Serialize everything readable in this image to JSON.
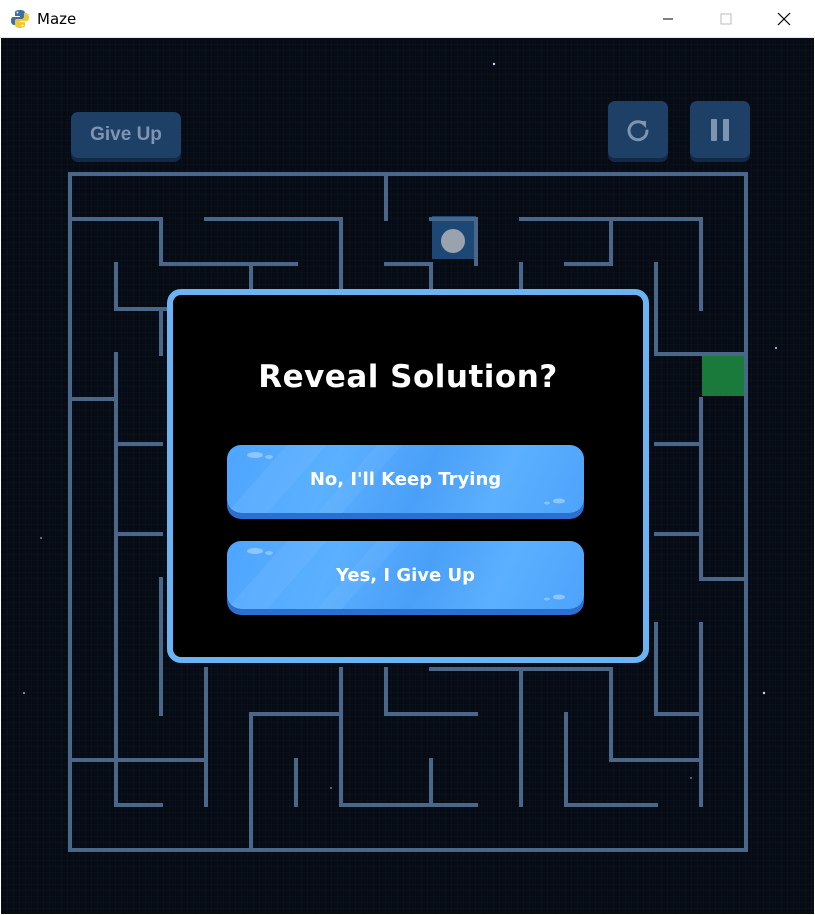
{
  "window": {
    "title": "Maze",
    "icon": "python-icon",
    "controls": [
      "minimize-icon",
      "maximize-icon",
      "close-icon"
    ]
  },
  "toolbar": {
    "give_up_label": "Give Up",
    "restart_icon": "restart-icon",
    "pause_icon": "pause-icon"
  },
  "maze": {
    "wall_color": "#4a6688",
    "player_color": "#9aa3ad",
    "player_cell_color": "#1d4876",
    "goal_color": "#1a7a3c",
    "background_color": "#070b14"
  },
  "modal": {
    "title": "Reveal Solution?",
    "border_color": "#6ab4f4",
    "no_label": "No, I'll Keep Trying",
    "yes_label": "Yes, I Give Up",
    "button_color": "#4ea5ff"
  }
}
